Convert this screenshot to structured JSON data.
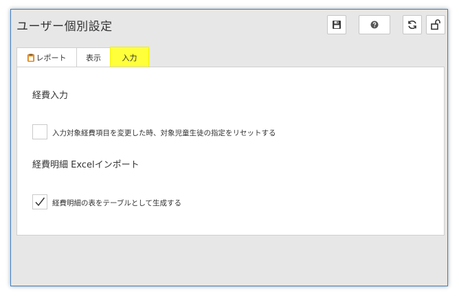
{
  "window": {
    "title": "ユーザー個別設定"
  },
  "toolbar": {
    "save_icon": "save-icon",
    "help_icon": "help-icon",
    "refresh_icon": "refresh-icon",
    "unlock_icon": "unlock-icon"
  },
  "tabs": [
    {
      "label": "レポート",
      "icon": "clipboard-icon",
      "active": false
    },
    {
      "label": "表示",
      "active": false
    },
    {
      "label": "入力",
      "active": true
    }
  ],
  "sections": [
    {
      "title": "経費入力",
      "option": {
        "label": "入力対象経費項目を変更した時、対象児童生徒の指定をリセットする",
        "checked": false
      }
    },
    {
      "title": "経費明細 Excelインポート",
      "option": {
        "label": "経費明細の表をテーブルとして生成する",
        "checked": true
      }
    }
  ],
  "colors": {
    "window_border": "#3b7fc8",
    "active_tab": "#ffff3a"
  }
}
